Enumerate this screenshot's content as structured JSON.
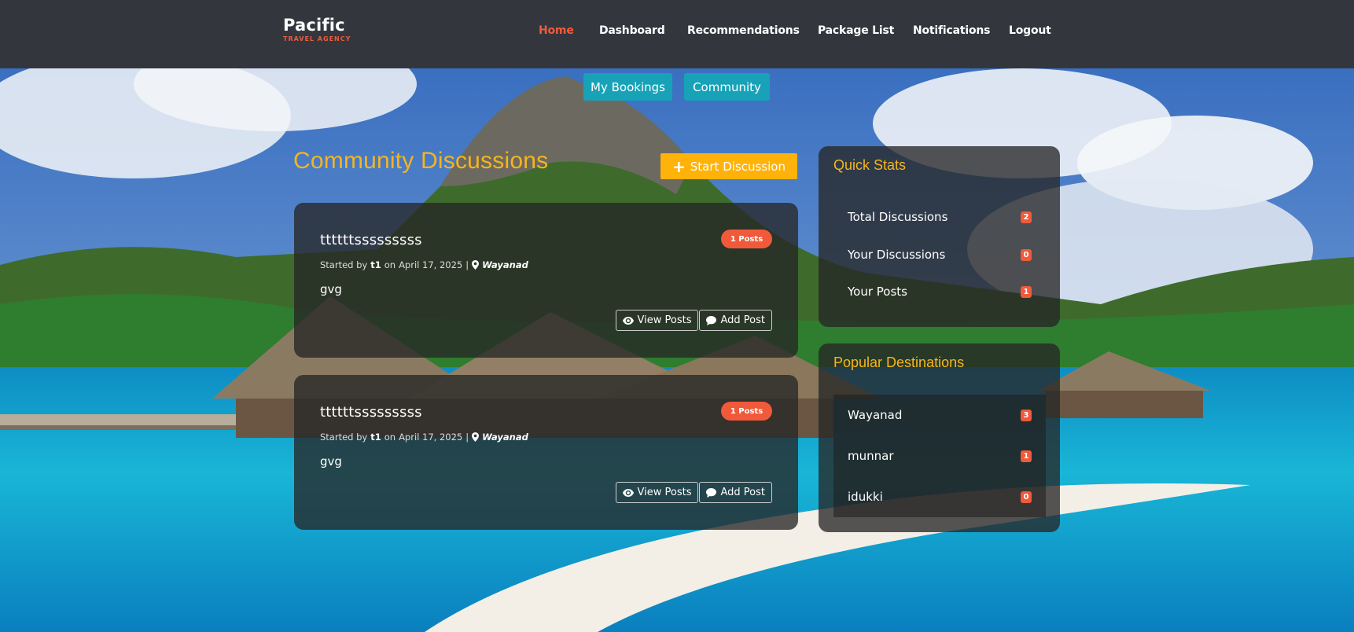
{
  "brand": {
    "name": "Pacific",
    "tagline": "TRAVEL AGENCY"
  },
  "nav": [
    {
      "label": "Home",
      "active": true
    },
    {
      "label": "Dashboard",
      "active": false
    },
    {
      "label": "Recommendations",
      "active": false
    },
    {
      "label": "Package List",
      "active": false
    },
    {
      "label": "Notifications",
      "active": false
    },
    {
      "label": "Logout",
      "active": false
    }
  ],
  "subnav": {
    "bookings": "My Bookings",
    "community": "Community"
  },
  "page": {
    "title": "Community Discussions",
    "start_button": "Start Discussion"
  },
  "discussions": [
    {
      "title": "ttttttsssssssss",
      "posts_badge": "1 Posts",
      "started_by_prefix": "Started by",
      "author": "t1",
      "on": "on",
      "date": "April 17, 2025",
      "separator": "|",
      "location": "Wayanad",
      "body": "gvg",
      "view_label": "View Posts",
      "add_label": "Add Post"
    },
    {
      "title": "ttttttsssssssss",
      "posts_badge": "1 Posts",
      "started_by_prefix": "Started by",
      "author": "t1",
      "on": "on",
      "date": "April 17, 2025",
      "separator": "|",
      "location": "Wayanad",
      "body": "gvg",
      "view_label": "View Posts",
      "add_label": "Add Post"
    }
  ],
  "quick_stats": {
    "title": "Quick Stats",
    "items": [
      {
        "label": "Total Discussions",
        "value": "2"
      },
      {
        "label": "Your Discussions",
        "value": "0"
      },
      {
        "label": "Your Posts",
        "value": "1"
      }
    ]
  },
  "popular_destinations": {
    "title": "Popular Destinations",
    "items": [
      {
        "label": "Wayanad",
        "value": "3"
      },
      {
        "label": "munnar",
        "value": "1"
      },
      {
        "label": "idukki",
        "value": "0"
      }
    ]
  },
  "colors": {
    "nav_bg": "#33373d",
    "accent_orange": "#f05a3b",
    "accent_yellow": "#f5b51f",
    "teal": "#17a2b8",
    "start_button": "#ffb30a"
  },
  "icons": [
    "eye-icon",
    "comment-icon",
    "map-pin-icon",
    "plus-icon"
  ]
}
